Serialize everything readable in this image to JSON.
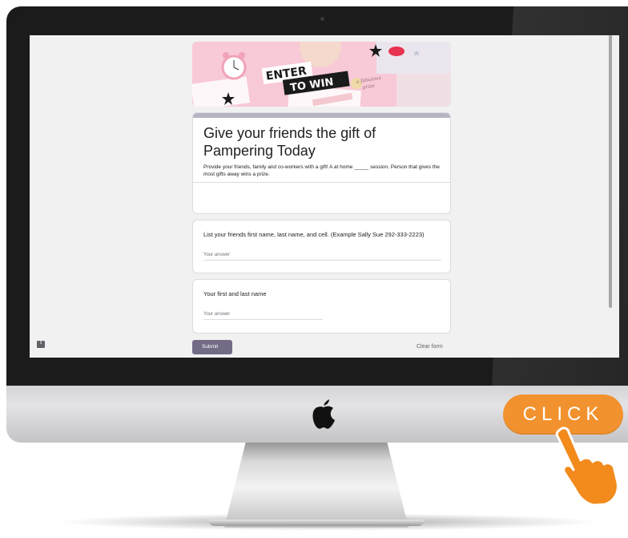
{
  "form": {
    "banner": {
      "headline_line1": "ENTER",
      "headline_line2": "TO WIN",
      "tag_line1": "a fabulous",
      "tag_line2": "prize"
    },
    "title": "Give your friends the gift of Pampering Today",
    "description": "Provide your friends, family and co-workers with a gift!  A at home _____ session.  Person that gives the most gifts away wins a prize.",
    "questions": [
      {
        "label": "List your friends first name, last name, and cell. (Example Sally Sue 292-333-2223)",
        "placeholder": "Your answer"
      },
      {
        "label": "Your first and last name",
        "placeholder": "Your answer"
      }
    ],
    "submit_label": "Submit",
    "clear_label": "Clear form"
  },
  "overlay": {
    "cta_label": "CLICK"
  },
  "colors": {
    "accent": "#b7b3c3",
    "submit": "#736b86",
    "cta": "#f2922f",
    "banner_pink": "#f7c6d3"
  },
  "icons": [
    "apple-logo-icon",
    "feedback-icon",
    "alarm-clock-icon",
    "star-icon",
    "pointing-hand-icon"
  ]
}
